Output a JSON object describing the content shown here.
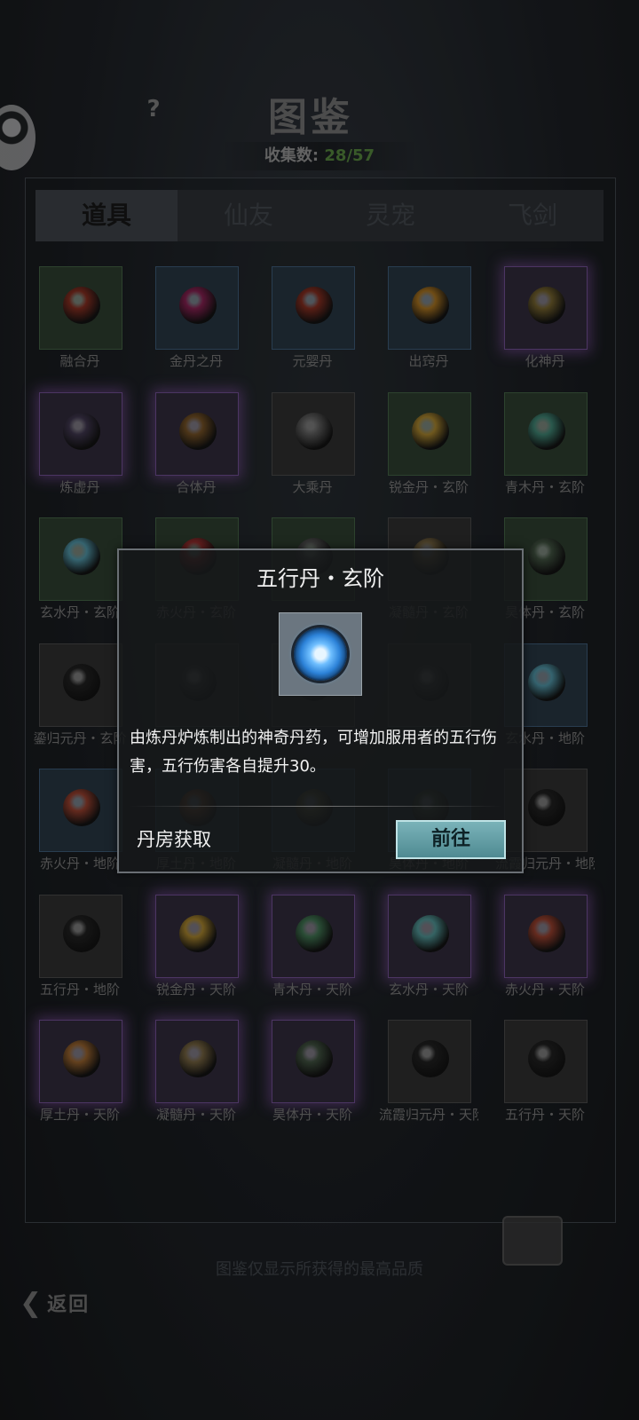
{
  "header": {
    "title": "图鉴",
    "help": "?",
    "collect_label": "收集数:",
    "collect_count": "28/57"
  },
  "tabs": [
    {
      "label": "道具",
      "active": true
    },
    {
      "label": "仙友",
      "active": false
    },
    {
      "label": "灵宠",
      "active": false
    },
    {
      "label": "飞剑",
      "active": false
    }
  ],
  "items": [
    {
      "label": "融合丹",
      "frame": "green",
      "orb": "#7a2a1e"
    },
    {
      "label": "金丹之丹",
      "frame": "blue",
      "orb": "#7a1e4a"
    },
    {
      "label": "元婴丹",
      "frame": "blue",
      "orb": "#7a2a1e"
    },
    {
      "label": "出窍丹",
      "frame": "blue",
      "orb": "#9a6a1e"
    },
    {
      "label": "化神丹",
      "frame": "purple",
      "orb": "#6a5a2a"
    },
    {
      "label": "炼虚丹",
      "frame": "purple",
      "orb": "#3a3248"
    },
    {
      "label": "合体丹",
      "frame": "purple",
      "orb": "#6a4a22"
    },
    {
      "label": "大乘丹",
      "frame": "gray",
      "orb": "#555555"
    },
    {
      "label": "锐金丹・玄阶",
      "frame": "green",
      "orb": "#9a7a2a"
    },
    {
      "label": "青木丹・玄阶",
      "frame": "green",
      "orb": "#3a7a6a"
    },
    {
      "label": "玄水丹・玄阶",
      "frame": "green",
      "orb": "#4a8a9a"
    },
    {
      "label": "赤火丹・玄阶",
      "frame": "green",
      "orb": "#8a2a2a"
    },
    {
      "label": "",
      "frame": "green",
      "orb": "#4a4a4a"
    },
    {
      "label": "凝髓丹・玄阶",
      "frame": "gray",
      "orb": "#6a5a3a"
    },
    {
      "label": "昊体丹・玄阶",
      "frame": "green",
      "orb": "#3a4a3a"
    },
    {
      "label": "鎏归元丹・玄阶",
      "frame": "gray",
      "orb": "#1e1e1e"
    },
    {
      "label": "",
      "frame": "gray",
      "orb": "#3a3a3a"
    },
    {
      "label": "",
      "frame": "gray",
      "orb": "#3a3a3a"
    },
    {
      "label": "",
      "frame": "gray",
      "orb": "#3a3a3a"
    },
    {
      "label": "玄水丹・地阶",
      "frame": "blue",
      "orb": "#4a8a9a"
    },
    {
      "label": "赤火丹・地阶",
      "frame": "blue",
      "orb": "#8a3a2a"
    },
    {
      "label": "厚土丹・地阶",
      "frame": "blue",
      "orb": "#7a4a2a"
    },
    {
      "label": "凝髓丹・地阶",
      "frame": "blue",
      "orb": "#5a5a3a"
    },
    {
      "label": "昊体丹・地阶",
      "frame": "blue",
      "orb": "#3a4a3a"
    },
    {
      "label": "流霞归元丹・地阶",
      "frame": "gray",
      "orb": "#1e1e1e"
    },
    {
      "label": "五行丹・地阶",
      "frame": "gray",
      "orb": "#1e1e1e"
    },
    {
      "label": "锐金丹・天阶",
      "frame": "purple",
      "orb": "#9a7a2a"
    },
    {
      "label": "青木丹・天阶",
      "frame": "purple",
      "orb": "#3a6a4a"
    },
    {
      "label": "玄水丹・天阶",
      "frame": "purple",
      "orb": "#4a8a8a"
    },
    {
      "label": "赤火丹・天阶",
      "frame": "purple",
      "orb": "#8a3a2a"
    },
    {
      "label": "厚土丹・天阶",
      "frame": "purple",
      "orb": "#8a5a2a"
    },
    {
      "label": "凝髓丹・天阶",
      "frame": "purple",
      "orb": "#6a5a3a"
    },
    {
      "label": "昊体丹・天阶",
      "frame": "purple",
      "orb": "#3a4a3a"
    },
    {
      "label": "流霞归元丹・天阶",
      "frame": "gray",
      "orb": "#1e1e1e"
    },
    {
      "label": "五行丹・天阶",
      "frame": "gray",
      "orb": "#1e1e1e"
    }
  ],
  "footer": {
    "hint": "图鉴仅显示所获得的最高品质",
    "back": "返回"
  },
  "popup": {
    "title": "五行丹・玄阶",
    "description": "由炼丹炉炼制出的神奇丹药，可增加服用者的五行伤害，五行伤害各自提升30。",
    "source": "丹房获取",
    "go_button": "前往"
  }
}
